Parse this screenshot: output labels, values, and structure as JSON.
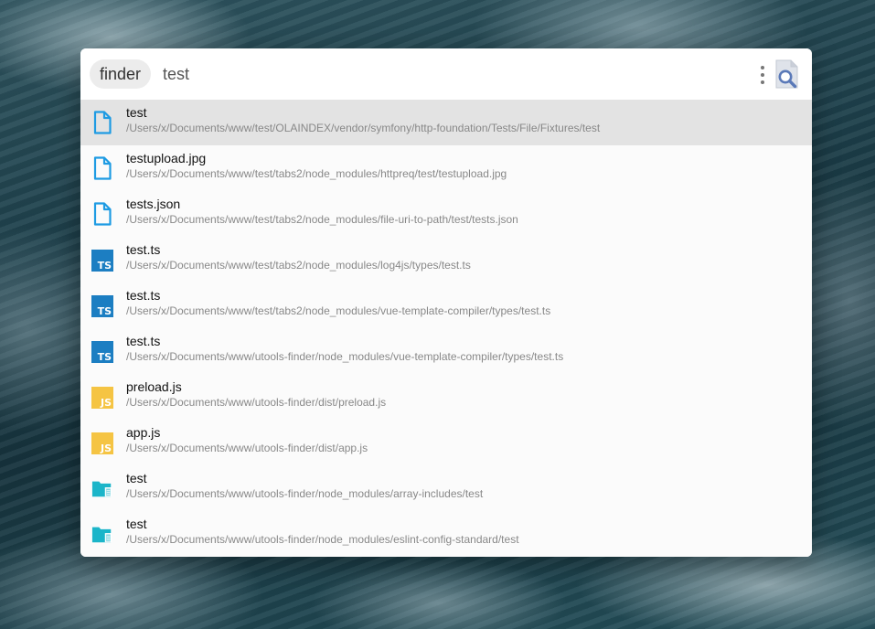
{
  "search": {
    "tag": "finder",
    "query": "test"
  },
  "colors": {
    "selected_row": "#e3e3e3",
    "file_icon": "#1e9be3",
    "ts_badge": "#1c7ec2",
    "js_badge": "#f5c443",
    "folder_icon": "#1bb5c9"
  },
  "results": [
    {
      "icon": "file-icon",
      "name": "test",
      "path": "/Users/x/Documents/www/test/OLAINDEX/vendor/symfony/http-foundation/Tests/File/Fixtures/test",
      "selected": true
    },
    {
      "icon": "file-icon",
      "name": "testupload.jpg",
      "path": "/Users/x/Documents/www/test/tabs2/node_modules/httpreq/test/testupload.jpg"
    },
    {
      "icon": "file-icon",
      "name": "tests.json",
      "path": "/Users/x/Documents/www/test/tabs2/node_modules/file-uri-to-path/test/tests.json"
    },
    {
      "icon": "typescript-icon",
      "badge": "TS",
      "name": "test.ts",
      "path": "/Users/x/Documents/www/test/tabs2/node_modules/log4js/types/test.ts"
    },
    {
      "icon": "typescript-icon",
      "badge": "TS",
      "name": "test.ts",
      "path": "/Users/x/Documents/www/test/tabs2/node_modules/vue-template-compiler/types/test.ts"
    },
    {
      "icon": "typescript-icon",
      "badge": "TS",
      "name": "test.ts",
      "path": "/Users/x/Documents/www/utools-finder/node_modules/vue-template-compiler/types/test.ts"
    },
    {
      "icon": "javascript-icon",
      "badge": "JS",
      "name": "preload.js",
      "path": "/Users/x/Documents/www/utools-finder/dist/preload.js"
    },
    {
      "icon": "javascript-icon",
      "badge": "JS",
      "name": "app.js",
      "path": "/Users/x/Documents/www/utools-finder/dist/app.js"
    },
    {
      "icon": "folder-icon",
      "name": "test",
      "path": "/Users/x/Documents/www/utools-finder/node_modules/array-includes/test"
    },
    {
      "icon": "folder-icon",
      "name": "test",
      "path": "/Users/x/Documents/www/utools-finder/node_modules/eslint-config-standard/test"
    }
  ]
}
